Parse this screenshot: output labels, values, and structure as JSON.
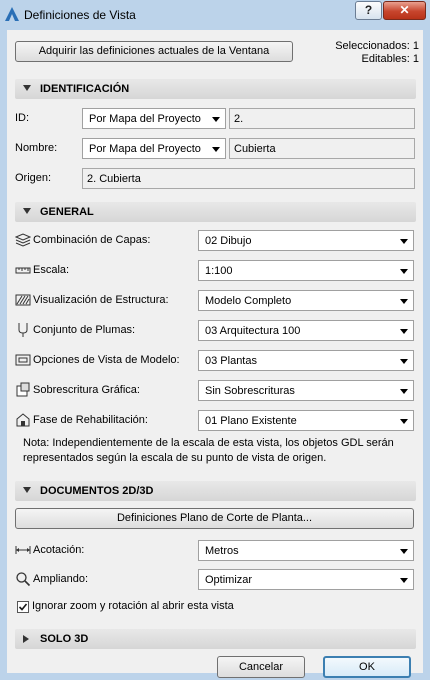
{
  "window": {
    "title": "Definiciones de Vista",
    "help_label": "?",
    "close_label": "✕"
  },
  "top": {
    "acquire_button": "Adquirir las definiciones actuales de la Ventana",
    "selected": "Seleccionados: 1",
    "editable": "Editables: 1"
  },
  "identification": {
    "header": "IDENTIFICACIÓN",
    "id_label": "ID:",
    "id_mode": "Por Mapa del Proyecto",
    "id_value": "2.",
    "name_label": "Nombre:",
    "name_mode": "Por Mapa del Proyecto",
    "name_value": "Cubierta",
    "source_label": "Origen:",
    "source_value": "2. Cubierta"
  },
  "general": {
    "header": "GENERAL",
    "rows": [
      {
        "label": "Combinación de Capas:",
        "value": "02 Dibujo",
        "icon": "layers-icon"
      },
      {
        "label": "Escala:",
        "value": "1:100",
        "icon": "ruler-icon"
      },
      {
        "label": "Visualización de Estructura:",
        "value": "Modelo Completo",
        "icon": "structure-icon"
      },
      {
        "label": "Conjunto de Plumas:",
        "value": "03 Arquitectura 100",
        "icon": "pen-icon"
      },
      {
        "label": "Opciones de Vista de Modelo:",
        "value": "03 Plantas",
        "icon": "model-view-icon"
      },
      {
        "label": "Sobrescritura Gráfica:",
        "value": "Sin Sobrescrituras",
        "icon": "graphic-override-icon"
      },
      {
        "label": "Fase de Rehabilitación:",
        "value": "01 Plano Existente",
        "icon": "renovation-icon"
      }
    ],
    "note": "Nota: Independientemente de la escala de esta vista, los objetos GDL serán representados según la escala de su punto de vista de origen."
  },
  "documents": {
    "header": "DOCUMENTOS 2D/3D",
    "cut_plane_button": "Definiciones Plano de Corte de Planta...",
    "dimension_label": "Acotación:",
    "dimension_value": "Metros",
    "zoom_label": "Ampliando:",
    "zoom_value": "Optimizar",
    "ignore_zoom_label": "Ignorar zoom y rotación al abrir esta vista",
    "ignore_zoom_checked": true
  },
  "solo3d": {
    "header": "SOLO 3D"
  },
  "footer": {
    "cancel": "Cancelar",
    "ok": "OK"
  },
  "colors": {
    "frame": "#bcd3ea",
    "client": "#f0f0f0",
    "close": "#c7452d",
    "ok_border": "#3c7fb1"
  }
}
